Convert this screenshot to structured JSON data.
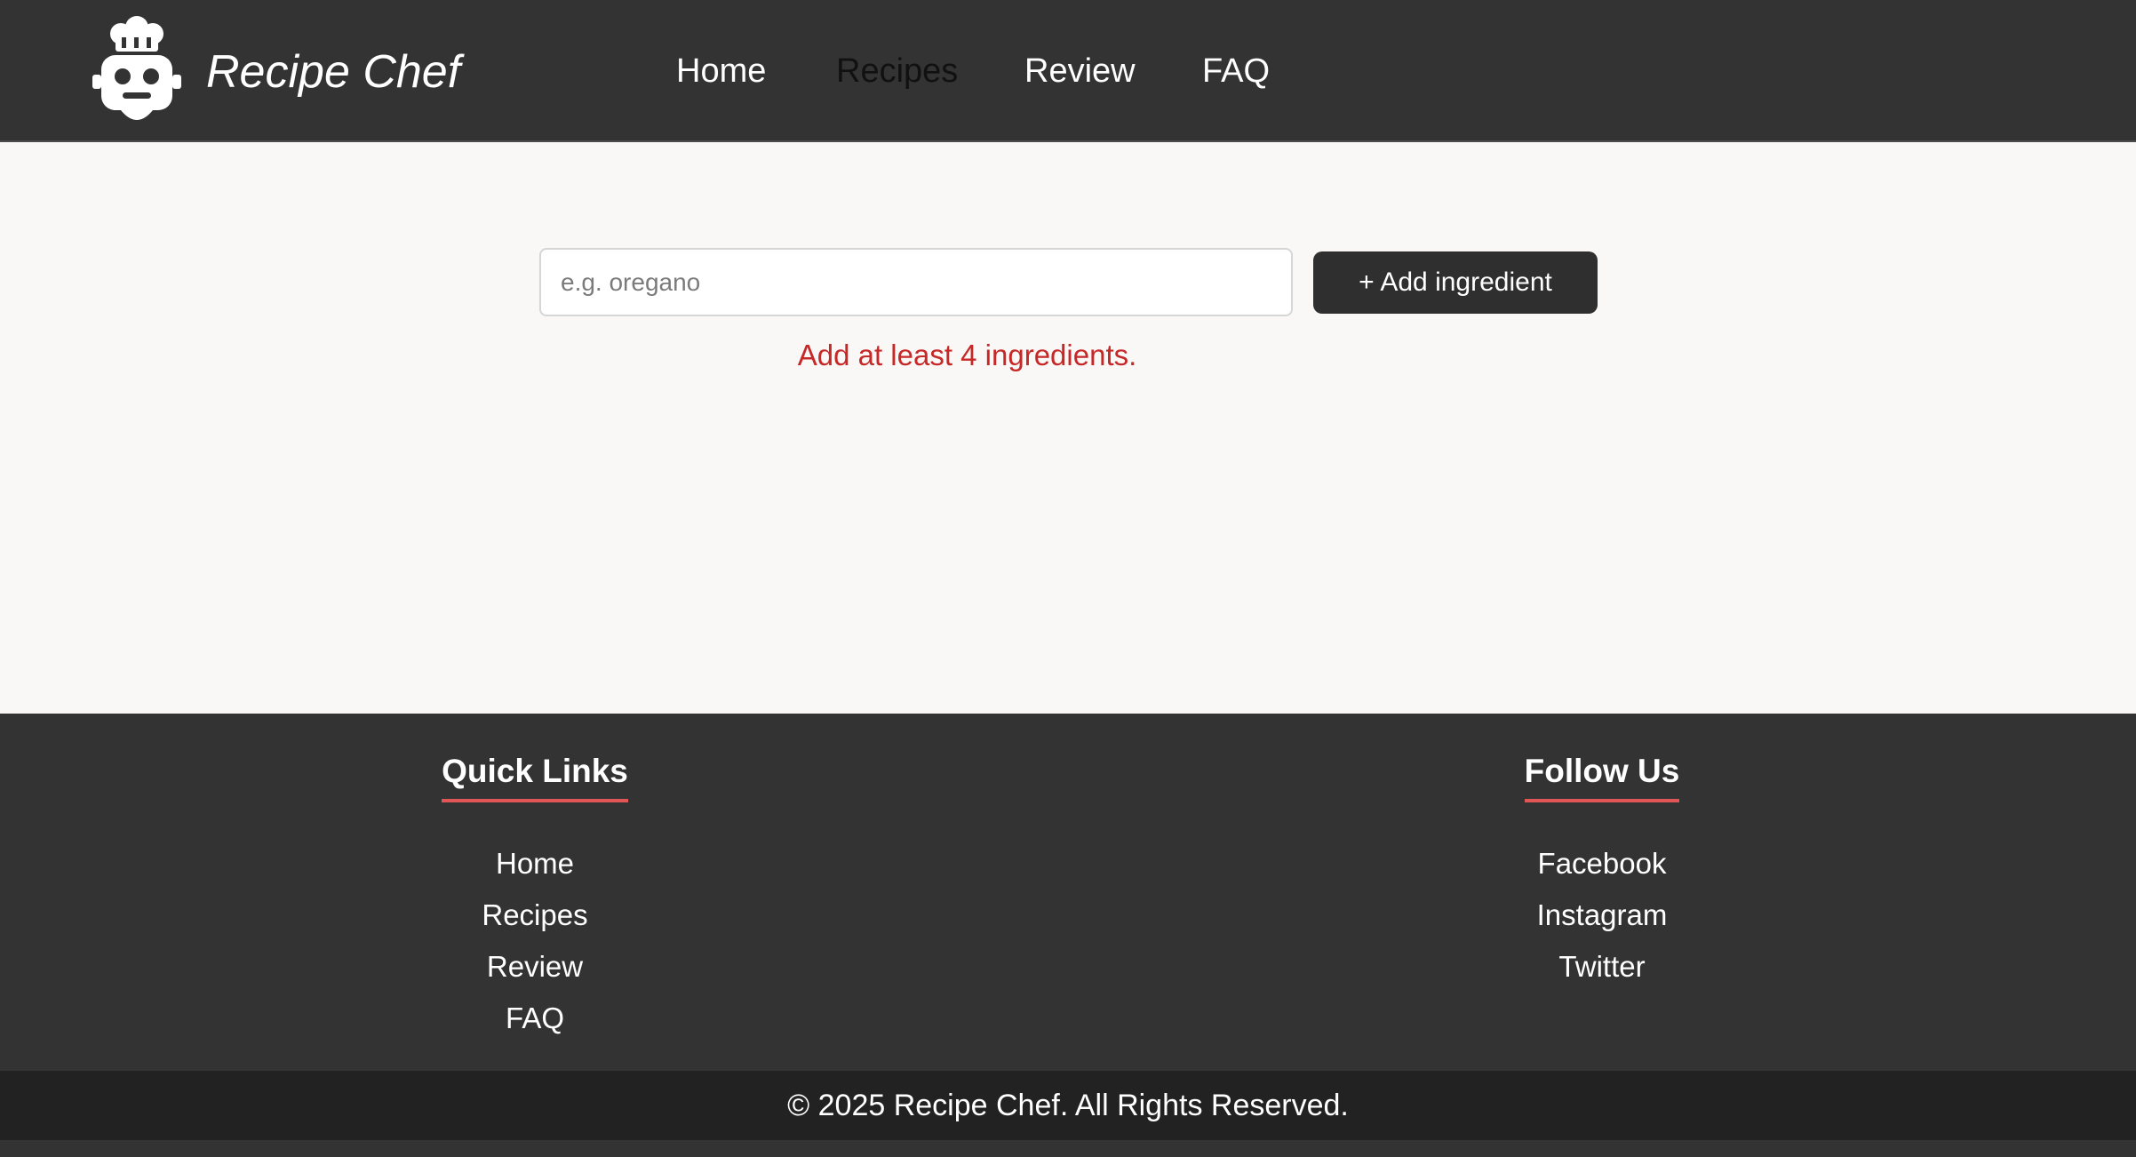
{
  "header": {
    "brand": "Recipe Chef",
    "logo_icon": "chef-robot-icon",
    "nav": {
      "home": "Home",
      "recipes": "Recipes",
      "review": "Review",
      "faq": "FAQ"
    },
    "active_nav": "Recipes"
  },
  "main": {
    "ingredient_input": {
      "placeholder": "e.g. oregano",
      "value": ""
    },
    "add_button_label": "+ Add ingredient",
    "error_message": "Add at least 4 ingredients."
  },
  "footer": {
    "quick_links": {
      "heading": "Quick Links",
      "items": [
        "Home",
        "Recipes",
        "Review",
        "FAQ"
      ]
    },
    "follow_us": {
      "heading": "Follow Us",
      "items": [
        "Facebook",
        "Instagram",
        "Twitter"
      ]
    },
    "copyright": "© 2025 Recipe Chef. All Rights Reserved."
  },
  "colors": {
    "header_bg": "#333333",
    "main_bg": "#f9f8f6",
    "accent_underline": "#e05555",
    "error": "#c62828",
    "button_bg": "#2f2f2f",
    "copyright_bg": "#222222"
  }
}
